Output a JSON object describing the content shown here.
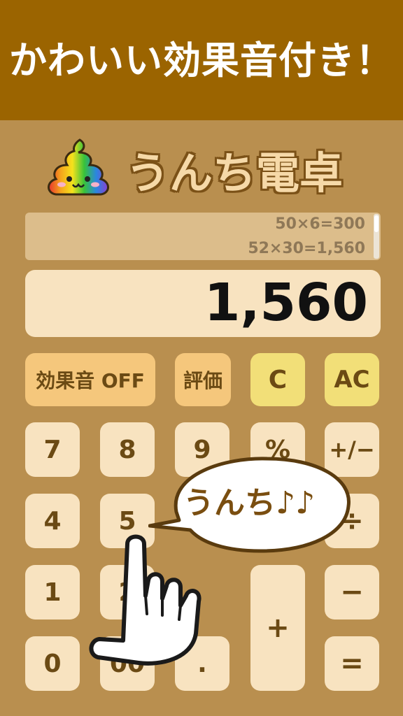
{
  "banner": {
    "text": "かわいい効果音付き！"
  },
  "app": {
    "title": "うんち電卓"
  },
  "history": {
    "lines": [
      "50×6=300",
      "52×30=1,560"
    ]
  },
  "display": {
    "value": "1,560"
  },
  "controls": {
    "sound_toggle": "効果音 OFF",
    "rate": "評価",
    "clear": "C",
    "all_clear": "AC"
  },
  "keys": {
    "seven": "7",
    "eight": "8",
    "nine": "9",
    "percent": "%",
    "plus_minus": "+/−",
    "four": "4",
    "five": "5",
    "divide": "÷",
    "one": "1",
    "two": "2",
    "minus": "−",
    "plus": "+",
    "zero": "0",
    "double_zero": "00",
    "dot": ".",
    "equals": "="
  },
  "bubble": {
    "text": "うんち♪♪"
  },
  "colors": {
    "banner_bg": "#9b6400",
    "body_bg": "#b98f4f",
    "key_bg": "#f8e3c0",
    "key_text": "#6b4a14",
    "orange_key": "#f5c77c",
    "yellow_key": "#f2df78"
  },
  "icons": {
    "logo": "rainbow-poop-icon",
    "hand": "pointing-hand-icon"
  }
}
